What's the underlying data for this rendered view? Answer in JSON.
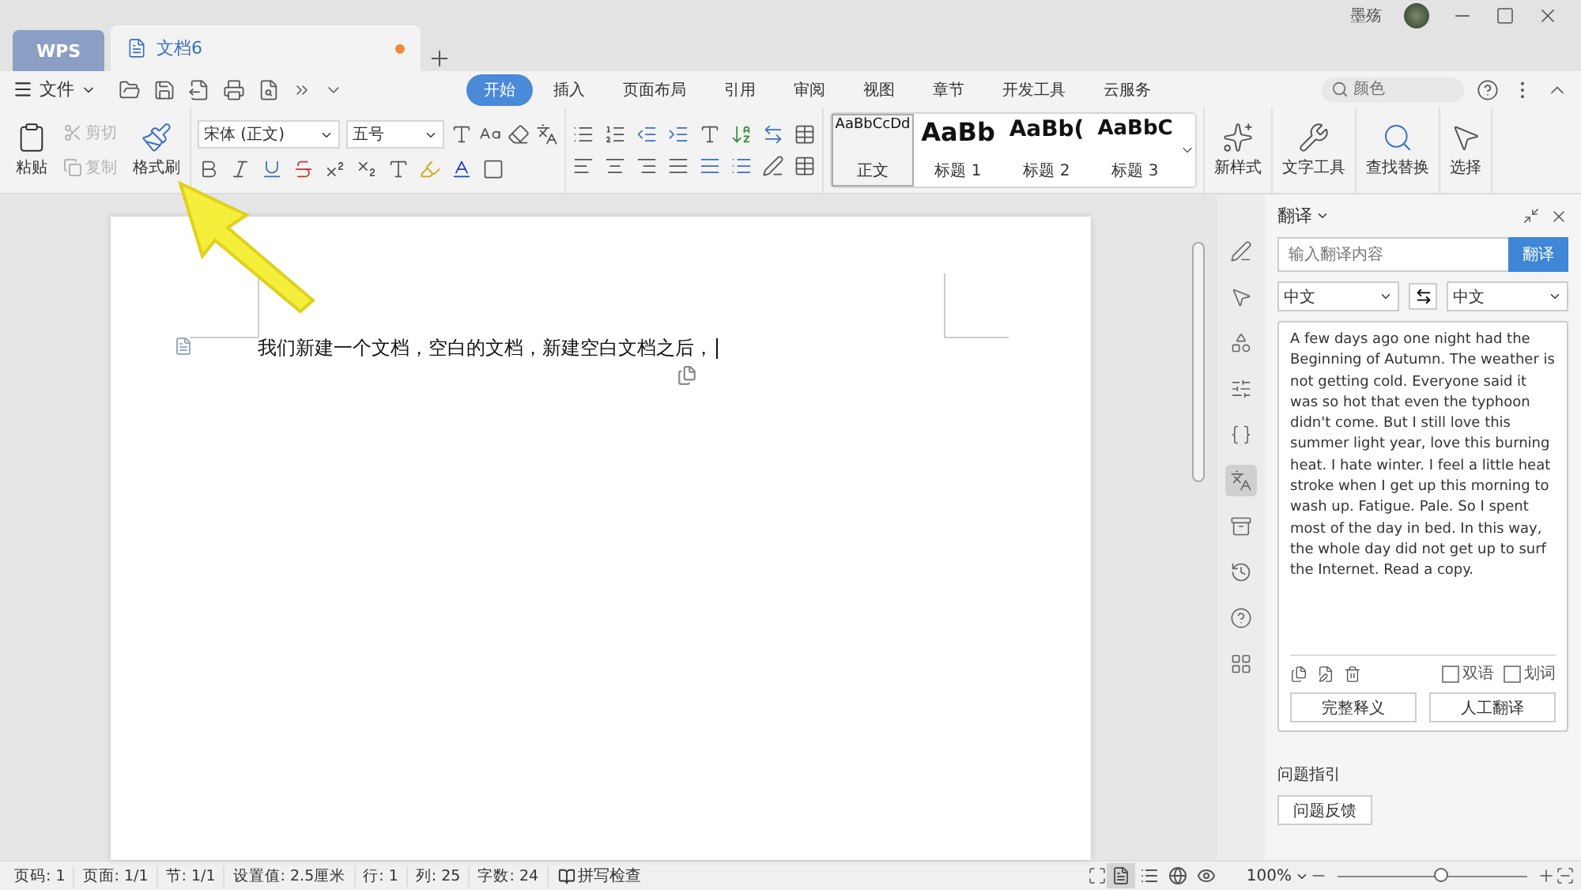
{
  "window": {
    "app_tab": "WPS",
    "tabs": [
      {
        "label": "文档6",
        "selected": true,
        "modified": true
      }
    ],
    "user": "墨殇"
  },
  "menu": {
    "file": "文件",
    "tabs": [
      {
        "label": "开始",
        "selected": true
      },
      {
        "label": "插入",
        "selected": false
      },
      {
        "label": "页面布局",
        "selected": false
      },
      {
        "label": "引用",
        "selected": false
      },
      {
        "label": "审阅",
        "selected": false
      },
      {
        "label": "视图",
        "selected": false
      },
      {
        "label": "章节",
        "selected": false
      },
      {
        "label": "开发工具",
        "selected": false
      },
      {
        "label": "云服务",
        "selected": false
      }
    ],
    "search": {
      "placeholder": "颜色"
    }
  },
  "ribbon": {
    "paste": "粘贴",
    "cut": {
      "label": "剪切",
      "disabled": true
    },
    "copy": {
      "label": "复制",
      "disabled": true
    },
    "format_painter": "格式刷",
    "font": "宋体 (正文)",
    "size": "五号",
    "styles": [
      {
        "sample": "AaBbCcDd",
        "name": "正文",
        "selected": true
      },
      {
        "sample": "AaBb",
        "name": "标题 1",
        "selected": false
      },
      {
        "sample": "AaBb(",
        "name": "标题 2",
        "selected": false
      },
      {
        "sample": "AaBbC",
        "name": "标题 3",
        "selected": false
      }
    ],
    "tools": [
      "新样式",
      "文字工具",
      "查找替换",
      "选择"
    ]
  },
  "document": {
    "paragraphs": [
      "我们新建一个文档，空白的文档，新建空白文档之后，"
    ]
  },
  "tool_strip": [
    {
      "selected": false
    },
    {
      "selected": false
    },
    {
      "selected": false
    },
    {
      "selected": false
    },
    {
      "selected": false
    },
    {
      "selected": true
    },
    {
      "selected": false
    },
    {
      "selected": false
    },
    {
      "selected": false
    },
    {
      "selected": false
    }
  ],
  "translate_panel": {
    "title": "翻译",
    "input": {
      "placeholder": "输入翻译内容"
    },
    "button": "翻译",
    "source_lang": "中文",
    "target_lang": "中文",
    "result": "A few days ago one night had the Beginning of Autumn. The weather is not getting cold. Everyone said it was so hot that even the typhoon didn't come. But I still love this summer light year, love this burning heat. I hate winter. I feel a little heat stroke when I get up this morning to wash up. Fatigue. Pale. So I spent most of the day in bed. In this way, the whole day did not get up to surf the Internet. Read a copy.",
    "options": [
      {
        "label": "双语",
        "checked": false
      },
      {
        "label": "划词",
        "checked": false
      }
    ],
    "actions": [
      "完整释义",
      "人工翻译"
    ],
    "help_title": "问题指引",
    "feedback": "问题反馈"
  },
  "status_bar": {
    "items": [
      "页码: 1",
      "页面: 1/1",
      "节: 1/1",
      "设置值: 2.5厘米",
      "行: 1",
      "列: 25",
      "字数: 24"
    ],
    "spell_check": "拼写检查",
    "views": [
      {
        "selected": true
      },
      {
        "selected": false
      },
      {
        "selected": false
      },
      {
        "selected": false
      }
    ],
    "zoom": "100%",
    "zoom_slider": {
      "level": 0.55
    }
  }
}
